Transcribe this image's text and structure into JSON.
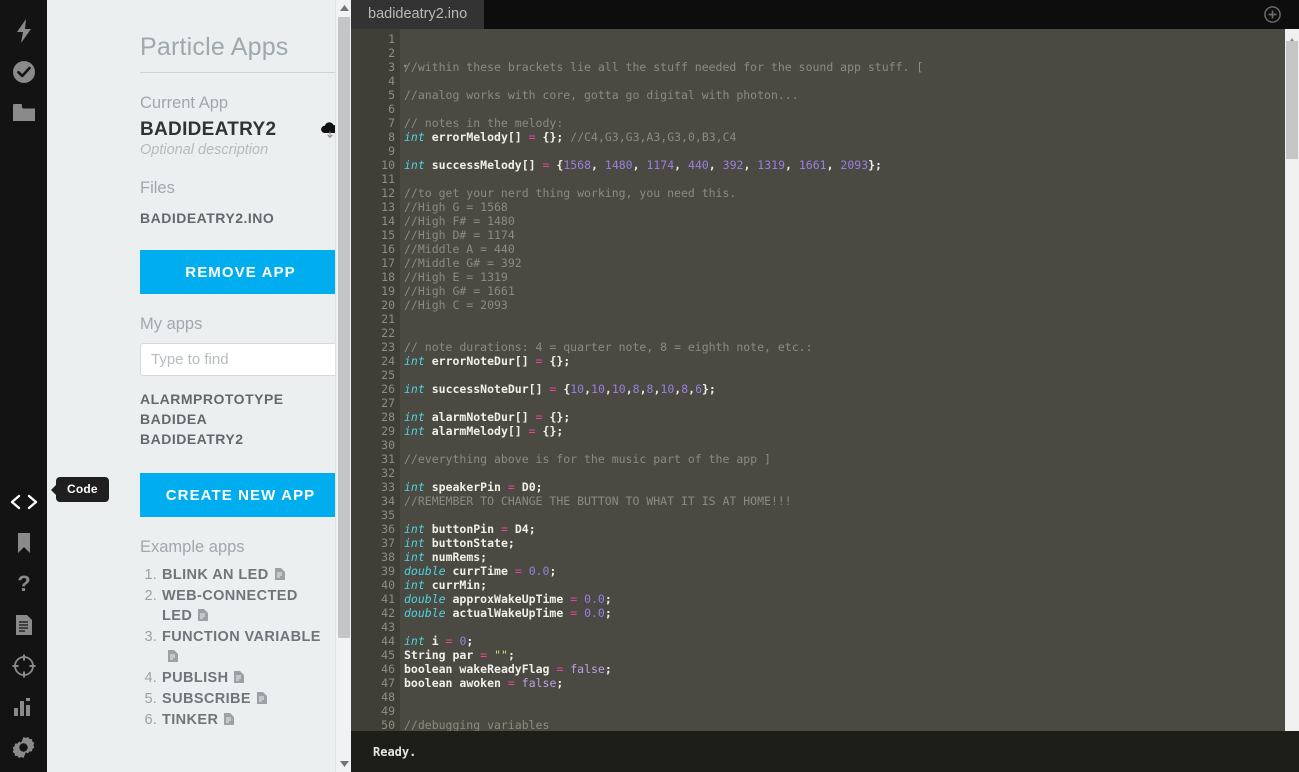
{
  "rail": {
    "top_icons": [
      {
        "name": "bolt-icon",
        "label": "Devices"
      },
      {
        "name": "check-circle-icon",
        "label": "Verify"
      },
      {
        "name": "folder-icon",
        "label": "Files"
      }
    ],
    "bottom_icons": [
      {
        "name": "code-icon",
        "label": "Code",
        "active": true
      },
      {
        "name": "bookmark-icon",
        "label": "Bookmarks"
      },
      {
        "name": "question-icon",
        "label": "Help"
      },
      {
        "name": "document-icon",
        "label": "Docs"
      },
      {
        "name": "target-icon",
        "label": "Target"
      },
      {
        "name": "bar-chart-icon",
        "label": "Logs"
      },
      {
        "name": "gear-icon",
        "label": "Settings"
      }
    ],
    "tooltip": "Code"
  },
  "sidebar": {
    "title": "Particle Apps",
    "current_app_heading": "Current App",
    "current_app_name": "BADIDEATRY2",
    "current_app_description": "Optional description",
    "cloud_icon": "cloud-download-icon",
    "files_heading": "Files",
    "files": [
      "BADIDEATRY2.INO"
    ],
    "remove_app_label": "REMOVE APP",
    "my_apps_heading": "My apps",
    "search_placeholder": "Type to find",
    "search_value": "",
    "my_apps": [
      "ALARMPROTOTYPE",
      "BADIDEA",
      "BADIDEATRY2"
    ],
    "create_new_app_label": "CREATE NEW APP",
    "example_apps_heading": "Example apps",
    "example_apps": [
      {
        "num": "1.",
        "label": "BLINK AN LED"
      },
      {
        "num": "2.",
        "label": "WEB-CONNECTED LED"
      },
      {
        "num": "3.",
        "label": "FUNCTION VARIABLE"
      },
      {
        "num": "4.",
        "label": "PUBLISH"
      },
      {
        "num": "5.",
        "label": "SUBSCRIBE"
      },
      {
        "num": "6.",
        "label": "TINKER"
      }
    ],
    "accent_color": "#00aeef",
    "panel_color": "#eceff0"
  },
  "editor": {
    "tab_label": "badideatry2.ino",
    "add_file_icon": "plus-circle-icon",
    "status_text": "Ready.",
    "first_line": 1,
    "background_color": "#4a4a42",
    "gutter_color": "#3f3f37",
    "fold_lines": [
      3
    ],
    "lines": [
      {
        "n": 1,
        "tokens": []
      },
      {
        "n": 2,
        "tokens": []
      },
      {
        "n": 3,
        "tokens": [
          {
            "t": "//within these brackets lie all the stuff needed for the sound app stuff. [",
            "c": "c-com"
          }
        ]
      },
      {
        "n": 4,
        "tokens": []
      },
      {
        "n": 5,
        "tokens": [
          {
            "t": "//analog works with core, gotta go digital with photon...",
            "c": "c-com"
          }
        ]
      },
      {
        "n": 6,
        "tokens": []
      },
      {
        "n": 7,
        "tokens": [
          {
            "t": "// notes in the melody:",
            "c": "c-com"
          }
        ]
      },
      {
        "n": 8,
        "tokens": [
          {
            "t": "int",
            "c": "c-kw"
          },
          {
            "t": " ",
            "c": ""
          },
          {
            "t": "errorMelody[]",
            "c": "c-id"
          },
          {
            "t": " ",
            "c": ""
          },
          {
            "t": "=",
            "c": "c-op"
          },
          {
            "t": " ",
            "c": ""
          },
          {
            "t": "{};",
            "c": "c-id"
          },
          {
            "t": " ",
            "c": ""
          },
          {
            "t": "//C4,G3,G3,A3,G3,0,B3,C4",
            "c": "c-com"
          }
        ]
      },
      {
        "n": 9,
        "tokens": []
      },
      {
        "n": 10,
        "tokens": [
          {
            "t": "int",
            "c": "c-kw"
          },
          {
            "t": " ",
            "c": ""
          },
          {
            "t": "successMelody[]",
            "c": "c-id"
          },
          {
            "t": " ",
            "c": ""
          },
          {
            "t": "=",
            "c": "c-op"
          },
          {
            "t": " ",
            "c": ""
          },
          {
            "t": "{",
            "c": "c-id"
          },
          {
            "t": "1568",
            "c": "c-num"
          },
          {
            "t": ", ",
            "c": "c-id"
          },
          {
            "t": "1480",
            "c": "c-num"
          },
          {
            "t": ", ",
            "c": "c-id"
          },
          {
            "t": "1174",
            "c": "c-num"
          },
          {
            "t": ", ",
            "c": "c-id"
          },
          {
            "t": "440",
            "c": "c-num"
          },
          {
            "t": ", ",
            "c": "c-id"
          },
          {
            "t": "392",
            "c": "c-num"
          },
          {
            "t": ", ",
            "c": "c-id"
          },
          {
            "t": "1319",
            "c": "c-num"
          },
          {
            "t": ", ",
            "c": "c-id"
          },
          {
            "t": "1661",
            "c": "c-num"
          },
          {
            "t": ", ",
            "c": "c-id"
          },
          {
            "t": "2093",
            "c": "c-num"
          },
          {
            "t": "};",
            "c": "c-id"
          }
        ]
      },
      {
        "n": 11,
        "tokens": []
      },
      {
        "n": 12,
        "tokens": [
          {
            "t": "//to get your nerd thing working, you need this.",
            "c": "c-com"
          }
        ]
      },
      {
        "n": 13,
        "tokens": [
          {
            "t": "//High G = 1568",
            "c": "c-com"
          }
        ]
      },
      {
        "n": 14,
        "tokens": [
          {
            "t": "//High F# = 1480",
            "c": "c-com"
          }
        ]
      },
      {
        "n": 15,
        "tokens": [
          {
            "t": "//High D# = 1174",
            "c": "c-com"
          }
        ]
      },
      {
        "n": 16,
        "tokens": [
          {
            "t": "//Middle A = 440",
            "c": "c-com"
          }
        ]
      },
      {
        "n": 17,
        "tokens": [
          {
            "t": "//Middle G# = 392",
            "c": "c-com"
          }
        ]
      },
      {
        "n": 18,
        "tokens": [
          {
            "t": "//High E = 1319",
            "c": "c-com"
          }
        ]
      },
      {
        "n": 19,
        "tokens": [
          {
            "t": "//High G# = 1661",
            "c": "c-com"
          }
        ]
      },
      {
        "n": 20,
        "tokens": [
          {
            "t": "//High C = 2093",
            "c": "c-com"
          }
        ]
      },
      {
        "n": 21,
        "tokens": []
      },
      {
        "n": 22,
        "tokens": []
      },
      {
        "n": 23,
        "tokens": [
          {
            "t": "// note durations: 4 = quarter note, 8 = eighth note, etc.:",
            "c": "c-com"
          }
        ]
      },
      {
        "n": 24,
        "tokens": [
          {
            "t": "int",
            "c": "c-kw"
          },
          {
            "t": " ",
            "c": ""
          },
          {
            "t": "errorNoteDur[]",
            "c": "c-id"
          },
          {
            "t": " ",
            "c": ""
          },
          {
            "t": "=",
            "c": "c-op"
          },
          {
            "t": " ",
            "c": ""
          },
          {
            "t": "{};",
            "c": "c-id"
          }
        ]
      },
      {
        "n": 25,
        "tokens": []
      },
      {
        "n": 26,
        "tokens": [
          {
            "t": "int",
            "c": "c-kw"
          },
          {
            "t": " ",
            "c": ""
          },
          {
            "t": "successNoteDur[]",
            "c": "c-id"
          },
          {
            "t": " ",
            "c": ""
          },
          {
            "t": "=",
            "c": "c-op"
          },
          {
            "t": " ",
            "c": ""
          },
          {
            "t": "{",
            "c": "c-id"
          },
          {
            "t": "10",
            "c": "c-num"
          },
          {
            "t": ",",
            "c": "c-id"
          },
          {
            "t": "10",
            "c": "c-num"
          },
          {
            "t": ",",
            "c": "c-id"
          },
          {
            "t": "10",
            "c": "c-num"
          },
          {
            "t": ",",
            "c": "c-id"
          },
          {
            "t": "8",
            "c": "c-num"
          },
          {
            "t": ",",
            "c": "c-id"
          },
          {
            "t": "8",
            "c": "c-num"
          },
          {
            "t": ",",
            "c": "c-id"
          },
          {
            "t": "10",
            "c": "c-num"
          },
          {
            "t": ",",
            "c": "c-id"
          },
          {
            "t": "8",
            "c": "c-num"
          },
          {
            "t": ",",
            "c": "c-id"
          },
          {
            "t": "6",
            "c": "c-num"
          },
          {
            "t": "};",
            "c": "c-id"
          }
        ]
      },
      {
        "n": 27,
        "tokens": []
      },
      {
        "n": 28,
        "tokens": [
          {
            "t": "int",
            "c": "c-kw"
          },
          {
            "t": " ",
            "c": ""
          },
          {
            "t": "alarmNoteDur[]",
            "c": "c-id"
          },
          {
            "t": " ",
            "c": ""
          },
          {
            "t": "=",
            "c": "c-op"
          },
          {
            "t": " ",
            "c": ""
          },
          {
            "t": "{};",
            "c": "c-id"
          }
        ]
      },
      {
        "n": 29,
        "tokens": [
          {
            "t": "int",
            "c": "c-kw"
          },
          {
            "t": " ",
            "c": ""
          },
          {
            "t": "alarmMelody[]",
            "c": "c-id"
          },
          {
            "t": " ",
            "c": ""
          },
          {
            "t": "=",
            "c": "c-op"
          },
          {
            "t": " ",
            "c": ""
          },
          {
            "t": "{};",
            "c": "c-id"
          }
        ]
      },
      {
        "n": 30,
        "tokens": []
      },
      {
        "n": 31,
        "tokens": [
          {
            "t": "//everything above is for the music part of the app ]",
            "c": "c-com"
          }
        ]
      },
      {
        "n": 32,
        "tokens": []
      },
      {
        "n": 33,
        "tokens": [
          {
            "t": "int",
            "c": "c-kw"
          },
          {
            "t": " ",
            "c": ""
          },
          {
            "t": "speakerPin",
            "c": "c-id"
          },
          {
            "t": " ",
            "c": ""
          },
          {
            "t": "=",
            "c": "c-op"
          },
          {
            "t": " ",
            "c": ""
          },
          {
            "t": "D0;",
            "c": "c-id"
          }
        ]
      },
      {
        "n": 34,
        "tokens": [
          {
            "t": "//REMEMBER TO CHANGE THE BUTTON TO WHAT IT IS AT HOME!!!",
            "c": "c-com"
          }
        ]
      },
      {
        "n": 35,
        "tokens": []
      },
      {
        "n": 36,
        "tokens": [
          {
            "t": "int",
            "c": "c-kw"
          },
          {
            "t": " ",
            "c": ""
          },
          {
            "t": "buttonPin",
            "c": "c-id"
          },
          {
            "t": " ",
            "c": ""
          },
          {
            "t": "=",
            "c": "c-op"
          },
          {
            "t": " ",
            "c": ""
          },
          {
            "t": "D4;",
            "c": "c-id"
          }
        ]
      },
      {
        "n": 37,
        "tokens": [
          {
            "t": "int",
            "c": "c-kw"
          },
          {
            "t": " ",
            "c": ""
          },
          {
            "t": "buttonState;",
            "c": "c-id"
          }
        ]
      },
      {
        "n": 38,
        "tokens": [
          {
            "t": "int",
            "c": "c-kw"
          },
          {
            "t": " ",
            "c": ""
          },
          {
            "t": "numRems;",
            "c": "c-id"
          }
        ]
      },
      {
        "n": 39,
        "tokens": [
          {
            "t": "double",
            "c": "c-kw"
          },
          {
            "t": " ",
            "c": ""
          },
          {
            "t": "currTime",
            "c": "c-id"
          },
          {
            "t": " ",
            "c": ""
          },
          {
            "t": "=",
            "c": "c-op"
          },
          {
            "t": " ",
            "c": ""
          },
          {
            "t": "0.0",
            "c": "c-num"
          },
          {
            "t": ";",
            "c": "c-id"
          }
        ]
      },
      {
        "n": 40,
        "tokens": [
          {
            "t": "int",
            "c": "c-kw"
          },
          {
            "t": " ",
            "c": ""
          },
          {
            "t": "currMin;",
            "c": "c-id"
          }
        ]
      },
      {
        "n": 41,
        "tokens": [
          {
            "t": "double",
            "c": "c-kw"
          },
          {
            "t": " ",
            "c": ""
          },
          {
            "t": "approxWakeUpTime",
            "c": "c-id"
          },
          {
            "t": " ",
            "c": ""
          },
          {
            "t": "=",
            "c": "c-op"
          },
          {
            "t": " ",
            "c": ""
          },
          {
            "t": "0.0",
            "c": "c-num"
          },
          {
            "t": ";",
            "c": "c-id"
          }
        ]
      },
      {
        "n": 42,
        "tokens": [
          {
            "t": "double",
            "c": "c-kw"
          },
          {
            "t": " ",
            "c": ""
          },
          {
            "t": "actualWakeUpTime",
            "c": "c-id"
          },
          {
            "t": " ",
            "c": ""
          },
          {
            "t": "=",
            "c": "c-op"
          },
          {
            "t": " ",
            "c": ""
          },
          {
            "t": "0.0",
            "c": "c-num"
          },
          {
            "t": ";",
            "c": "c-id"
          }
        ]
      },
      {
        "n": 43,
        "tokens": []
      },
      {
        "n": 44,
        "tokens": [
          {
            "t": "int",
            "c": "c-kw"
          },
          {
            "t": " ",
            "c": ""
          },
          {
            "t": "i",
            "c": "c-id"
          },
          {
            "t": " ",
            "c": ""
          },
          {
            "t": "=",
            "c": "c-op"
          },
          {
            "t": " ",
            "c": ""
          },
          {
            "t": "0",
            "c": "c-num"
          },
          {
            "t": ";",
            "c": "c-id"
          }
        ]
      },
      {
        "n": 45,
        "tokens": [
          {
            "t": "String",
            "c": "c-type"
          },
          {
            "t": " ",
            "c": ""
          },
          {
            "t": "par",
            "c": "c-id"
          },
          {
            "t": " ",
            "c": ""
          },
          {
            "t": "=",
            "c": "c-op"
          },
          {
            "t": " ",
            "c": ""
          },
          {
            "t": "\"\"",
            "c": "c-str"
          },
          {
            "t": ";",
            "c": "c-id"
          }
        ]
      },
      {
        "n": 46,
        "tokens": [
          {
            "t": "boolean",
            "c": "c-type"
          },
          {
            "t": " ",
            "c": ""
          },
          {
            "t": "wakeReadyFlag",
            "c": "c-id"
          },
          {
            "t": " ",
            "c": ""
          },
          {
            "t": "=",
            "c": "c-op"
          },
          {
            "t": " ",
            "c": ""
          },
          {
            "t": "false",
            "c": "c-bool"
          },
          {
            "t": ";",
            "c": "c-id"
          }
        ]
      },
      {
        "n": 47,
        "tokens": [
          {
            "t": "boolean",
            "c": "c-type"
          },
          {
            "t": " ",
            "c": ""
          },
          {
            "t": "awoken",
            "c": "c-id"
          },
          {
            "t": " ",
            "c": ""
          },
          {
            "t": "=",
            "c": "c-op"
          },
          {
            "t": " ",
            "c": ""
          },
          {
            "t": "false",
            "c": "c-bool"
          },
          {
            "t": ";",
            "c": "c-id"
          }
        ]
      },
      {
        "n": 48,
        "tokens": []
      },
      {
        "n": 49,
        "tokens": []
      },
      {
        "n": 50,
        "tokens": [
          {
            "t": "//debugging variables",
            "c": "c-com"
          }
        ]
      }
    ]
  }
}
